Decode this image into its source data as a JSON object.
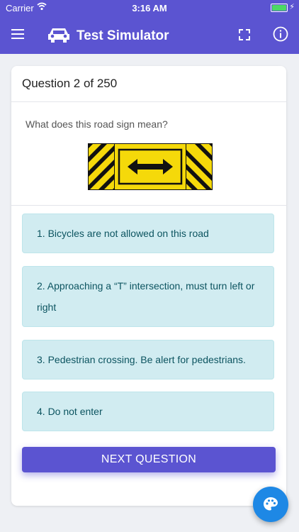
{
  "status_bar": {
    "carrier": "Carrier",
    "time": "3:16 AM",
    "battery_level": 1.0
  },
  "nav": {
    "title": "Test Simulator"
  },
  "question": {
    "counter": "Question 2 of 250",
    "text": "What does this road sign mean?",
    "sign_icon": "double-arrow-road-sign"
  },
  "answers": [
    {
      "label": "1. Bicycles are not allowed on this road"
    },
    {
      "label": "2. Approaching a “T” intersection, must turn left or right"
    },
    {
      "label": "3. Pedestrian crossing. Be alert for pedestrians."
    },
    {
      "label": "4. Do not enter"
    }
  ],
  "next_button": {
    "label": "NEXT QUESTION"
  },
  "colors": {
    "brand": "#5b54d1",
    "answer_bg": "#d1ecf1",
    "answer_text": "#0c5460",
    "fab": "#1e88e5"
  },
  "icons": {
    "menu": "menu-icon",
    "car": "car-icon",
    "fullscreen": "fullscreen-icon",
    "info": "info-icon",
    "palette": "palette-icon"
  }
}
